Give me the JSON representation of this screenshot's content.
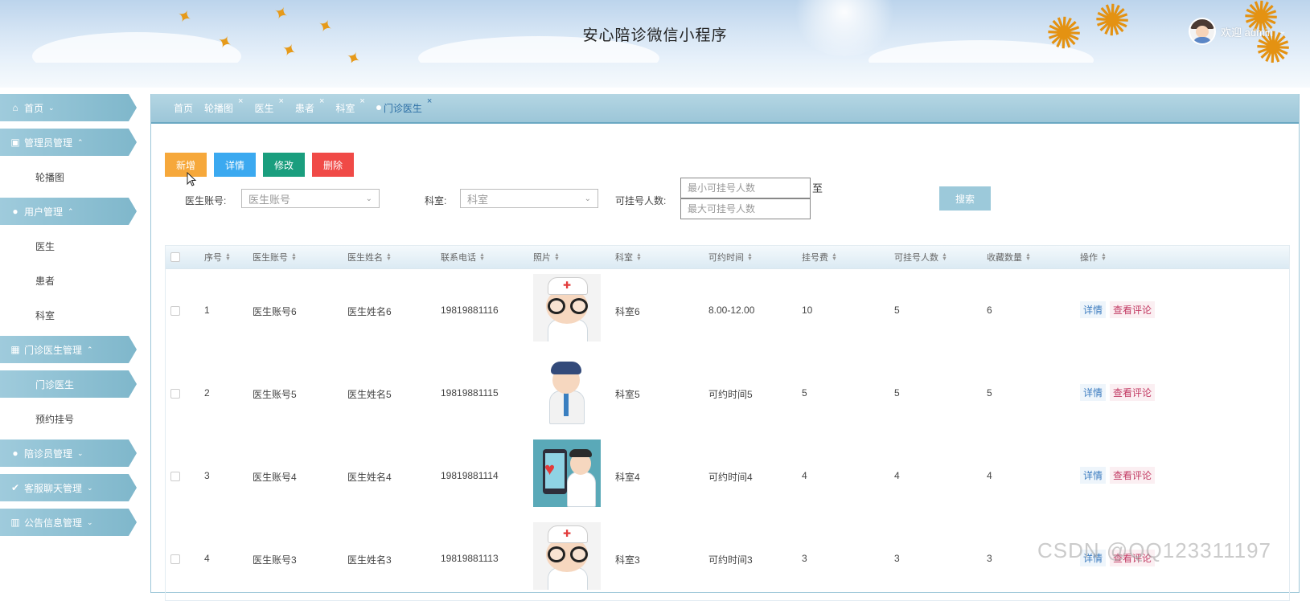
{
  "header": {
    "title": "安心陪诊微信小程序",
    "welcome": "欢迎 admin"
  },
  "sidebar": {
    "items": [
      {
        "label": "首页",
        "type": "group",
        "icon": "home-icon"
      },
      {
        "label": "管理员管理",
        "type": "group",
        "icon": "gift-icon"
      },
      {
        "label": "轮播图",
        "type": "sub"
      },
      {
        "label": "用户管理",
        "type": "group",
        "icon": "user-icon"
      },
      {
        "label": "医生",
        "type": "sub"
      },
      {
        "label": "患者",
        "type": "sub"
      },
      {
        "label": "科室",
        "type": "sub"
      },
      {
        "label": "门诊医生管理",
        "type": "group",
        "icon": "building-icon"
      },
      {
        "label": "门诊医生",
        "type": "sub",
        "active": true
      },
      {
        "label": "预约挂号",
        "type": "sub"
      },
      {
        "label": "陪诊员管理",
        "type": "group",
        "icon": "user-icon"
      },
      {
        "label": "客服聊天管理",
        "type": "group",
        "icon": "check-circle-icon"
      },
      {
        "label": "公告信息管理",
        "type": "group",
        "icon": "chart-icon"
      }
    ]
  },
  "tabs": [
    {
      "label": "首页",
      "closable": false
    },
    {
      "label": "轮播图",
      "closable": true
    },
    {
      "label": "医生",
      "closable": true
    },
    {
      "label": "患者",
      "closable": true
    },
    {
      "label": "科室",
      "closable": true
    },
    {
      "label": "门诊医生",
      "closable": true,
      "active": true
    }
  ],
  "tab_close": "×",
  "toolbar": {
    "add": "新增",
    "detail": "详情",
    "edit": "修改",
    "delete": "删除",
    "search": "搜索"
  },
  "filters": {
    "account_label": "医生账号:",
    "account_placeholder": "医生账号",
    "dept_label": "科室:",
    "dept_placeholder": "科室",
    "count_label": "可挂号人数:",
    "min_placeholder": "最小可挂号人数",
    "max_placeholder": "最大可挂号人数",
    "to": "至"
  },
  "table": {
    "columns": [
      "序号",
      "医生账号",
      "医生姓名",
      "联系电话",
      "照片",
      "科室",
      "可约时间",
      "挂号费",
      "可挂号人数",
      "收藏数量",
      "操作"
    ],
    "rows": [
      {
        "no": "1",
        "account": "医生账号6",
        "name": "医生姓名6",
        "phone": "19819881116",
        "dept": "科室6",
        "time": "8.00-12.00",
        "fee": "10",
        "count": "5",
        "fav": "6",
        "img": "doctor-cap"
      },
      {
        "no": "2",
        "account": "医生账号5",
        "name": "医生姓名5",
        "phone": "19819881115",
        "dept": "科室5",
        "time": "可约时间5",
        "fee": "5",
        "count": "5",
        "fav": "5",
        "img": "doctor-standing"
      },
      {
        "no": "3",
        "account": "医生账号4",
        "name": "医生姓名4",
        "phone": "19819881114",
        "dept": "科室4",
        "time": "可约时间4",
        "fee": "4",
        "count": "4",
        "fav": "4",
        "img": "doctor-phone"
      },
      {
        "no": "4",
        "account": "医生账号3",
        "name": "医生姓名3",
        "phone": "19819881113",
        "dept": "科室3",
        "time": "可约时间3",
        "fee": "3",
        "count": "3",
        "fav": "3",
        "img": "doctor-cap"
      }
    ],
    "op_detail": "详情",
    "op_comment": "查看评论"
  },
  "watermark": "CSDN @QQ123311197"
}
